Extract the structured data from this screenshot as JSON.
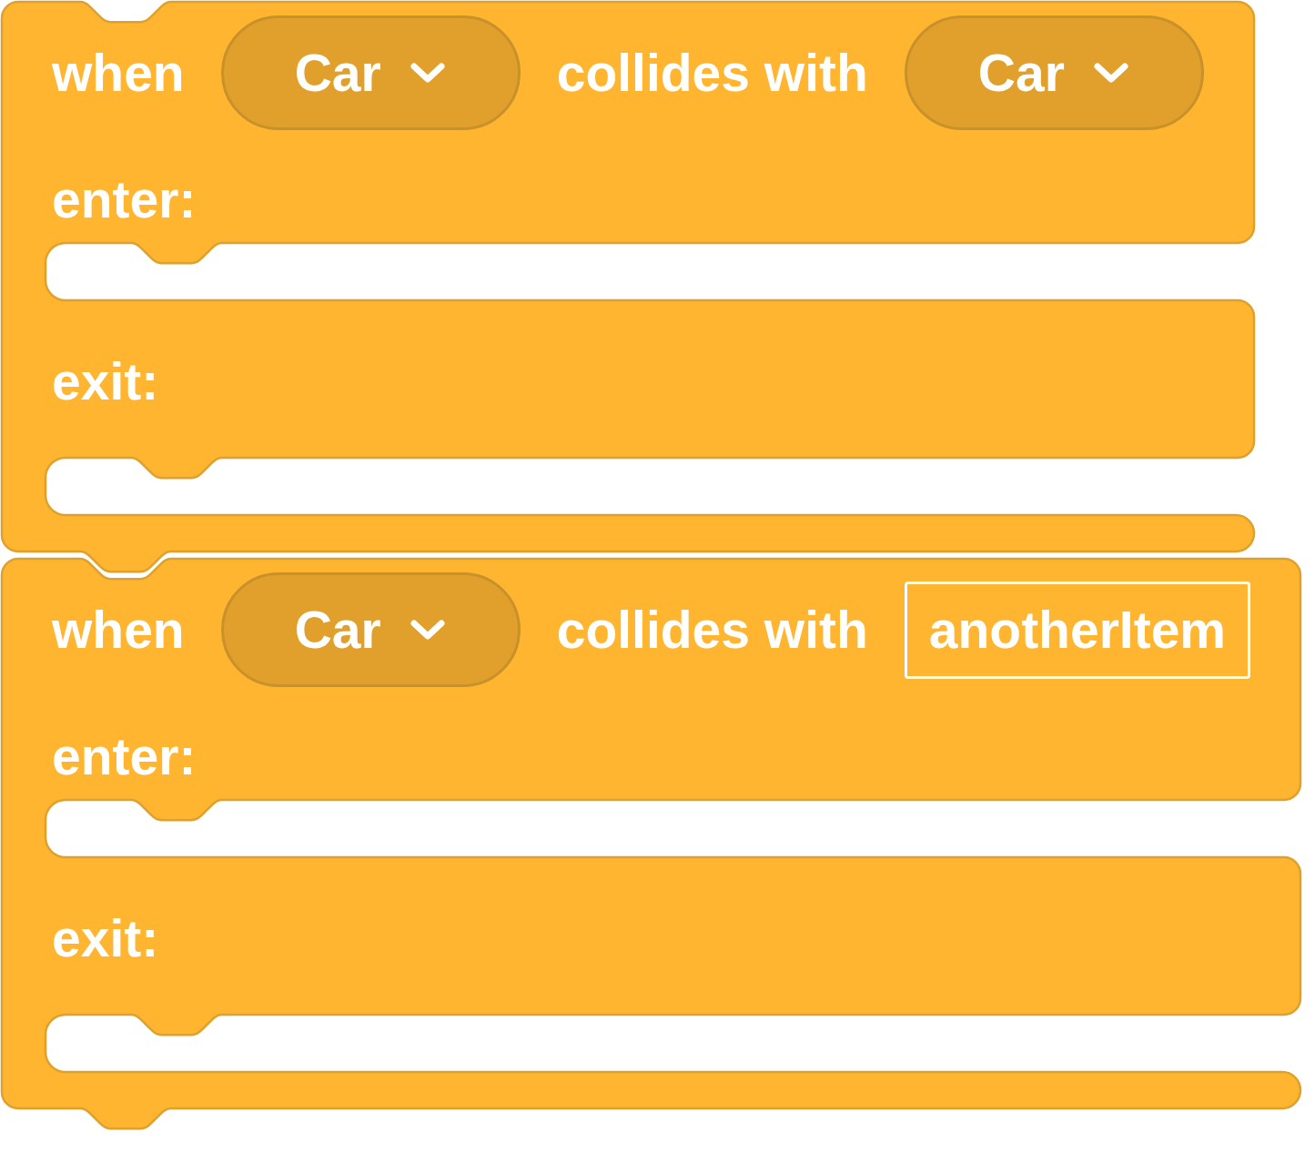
{
  "blocks": [
    {
      "header": [
        {
          "kind": "text",
          "text": "when"
        },
        {
          "kind": "dropdown",
          "value": "Car"
        },
        {
          "kind": "text",
          "text": "collides with"
        },
        {
          "kind": "dropdown",
          "value": "Car"
        }
      ],
      "sections": [
        {
          "label": "enter:"
        },
        {
          "label": "exit:"
        }
      ]
    },
    {
      "header": [
        {
          "kind": "text",
          "text": "when"
        },
        {
          "kind": "dropdown",
          "value": "Car"
        },
        {
          "kind": "text",
          "text": "collides with"
        },
        {
          "kind": "field",
          "value": "anotherItem"
        }
      ],
      "sections": [
        {
          "label": "enter:"
        },
        {
          "label": "exit:"
        }
      ]
    }
  ]
}
